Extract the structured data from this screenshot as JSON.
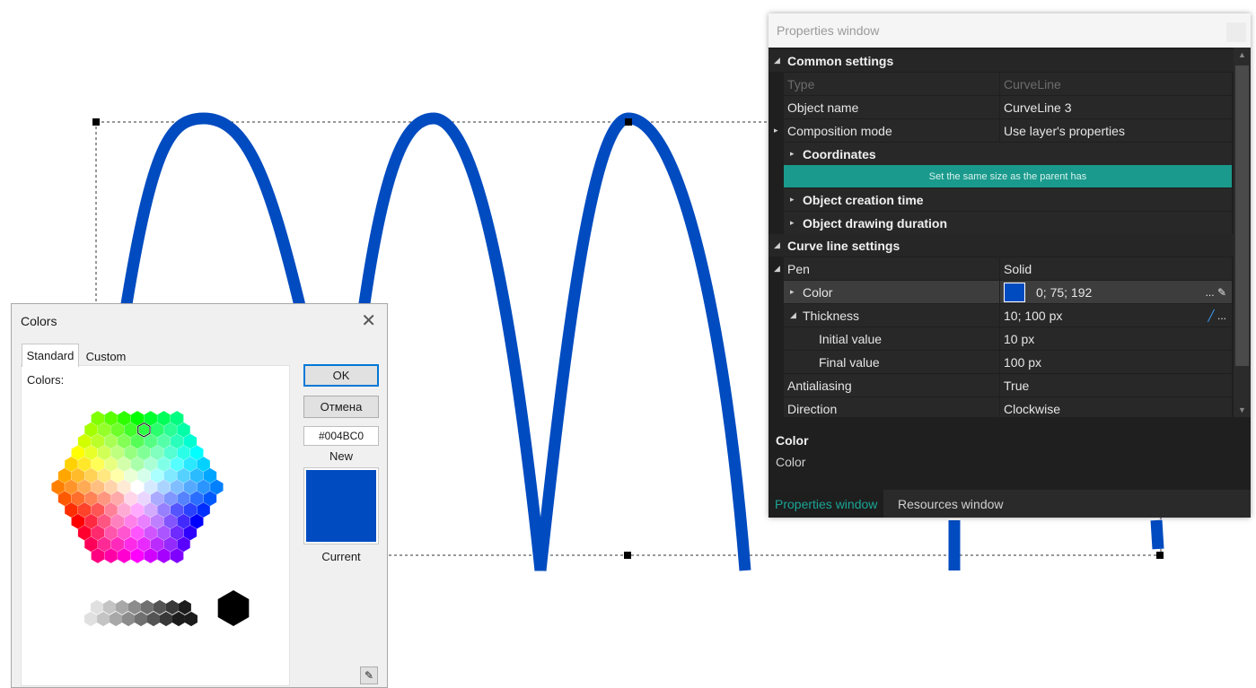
{
  "canvas": {
    "curve_color": "#004bc0"
  },
  "properties": {
    "title": "Properties window",
    "common_settings": "Common settings",
    "rows": {
      "type_label": "Type",
      "type_value": "CurveLine",
      "name_label": "Object name",
      "name_value": "CurveLine 3",
      "comp_label": "Composition mode",
      "comp_value": "Use layer's properties",
      "coordinates": "Coordinates",
      "same_size_button": "Set the same size as the parent has",
      "creation_time": "Object creation time",
      "drawing_duration": "Object drawing duration",
      "curve_settings": "Curve line settings",
      "pen_label": "Pen",
      "pen_value": "Solid",
      "color_label": "Color",
      "color_value": "0; 75; 192",
      "color_more": "...",
      "thickness_label": "Thickness",
      "thickness_value": "10; 100 px",
      "thickness_more": "...",
      "initial_label": "Initial value",
      "initial_value": "10 px",
      "final_label": "Final value",
      "final_value": "100 px",
      "antialias_label": "Antialiasing",
      "antialias_value": "True",
      "direction_label": "Direction",
      "direction_value": "Clockwise"
    },
    "description": {
      "title": "Color",
      "text": "Color"
    },
    "tabs": {
      "active": "Properties window",
      "inactive": "Resources window"
    },
    "swatch_color": "#004bc0"
  },
  "colors_dialog": {
    "title": "Colors",
    "close": "✕",
    "tab_standard": "Standard",
    "tab_custom": "Custom",
    "colors_label": "Colors:",
    "ok": "OK",
    "cancel": "Отмена",
    "hex_value": "#004BC0",
    "new_label": "New",
    "current_label": "Current",
    "eyedropper_icon": "eyedropper-icon"
  }
}
